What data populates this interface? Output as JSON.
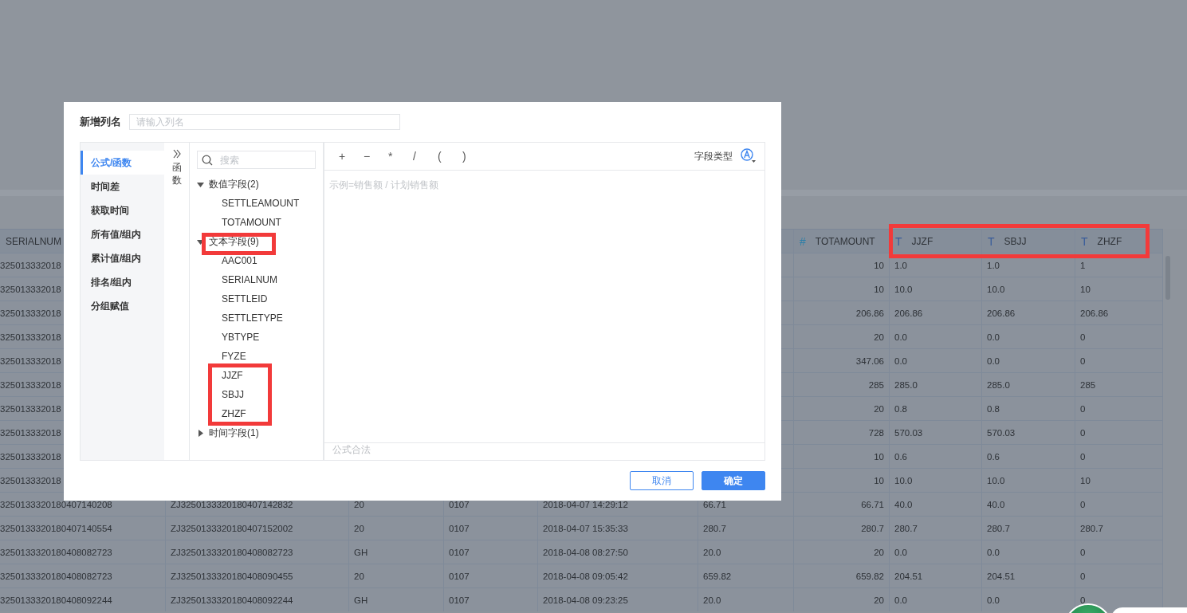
{
  "table": {
    "columns": [
      {
        "label": "SERIALNUM"
      },
      {},
      {},
      {},
      {},
      {},
      {
        "label": "TOTAMOUNT",
        "kind": "number",
        "icon": "#"
      },
      {
        "label": "JJZF",
        "kind": "text",
        "icon": "T"
      },
      {
        "label": "SBJJ",
        "kind": "text",
        "icon": "T"
      },
      {
        "label": "ZHZF",
        "kind": "text",
        "icon": "T"
      }
    ],
    "rows": [
      [
        "325013332018",
        null,
        null,
        null,
        null,
        null,
        "10",
        "1.0",
        "1.0",
        "1"
      ],
      [
        "325013332018",
        null,
        null,
        null,
        null,
        null,
        "10",
        "10.0",
        "10.0",
        "10"
      ],
      [
        "325013332018",
        null,
        null,
        null,
        null,
        null,
        "206.86",
        "206.86",
        "206.86",
        "206.86"
      ],
      [
        "325013332018",
        null,
        null,
        null,
        null,
        null,
        "20",
        "0.0",
        "0.0",
        "0"
      ],
      [
        "325013332018",
        null,
        null,
        null,
        null,
        null,
        "347.06",
        "0.0",
        "0.0",
        "0"
      ],
      [
        "325013332018",
        null,
        null,
        null,
        null,
        null,
        "285",
        "285.0",
        "285.0",
        "285"
      ],
      [
        "325013332018",
        null,
        null,
        null,
        null,
        null,
        "20",
        "0.8",
        "0.8",
        "0"
      ],
      [
        "325013332018",
        null,
        null,
        null,
        null,
        null,
        "728",
        "570.03",
        "570.03",
        "0"
      ],
      [
        "325013332018",
        null,
        null,
        null,
        null,
        null,
        "10",
        "0.6",
        "0.6",
        "0"
      ],
      [
        "325013332018",
        null,
        null,
        null,
        null,
        null,
        "10",
        "10.0",
        "10.0",
        "10"
      ],
      [
        "3250133320180407140208",
        "ZJ3250133320180407142832",
        "20",
        "0107",
        "2018-04-07 14:29:12",
        "66.71",
        "66.71",
        "40.0",
        "40.0",
        "0"
      ],
      [
        "3250133320180407140554",
        "ZJ3250133320180407152002",
        "20",
        "0107",
        "2018-04-07 15:35:33",
        "280.7",
        "280.7",
        "280.7",
        "280.7",
        "280.7"
      ],
      [
        "3250133320180408082723",
        "ZJ3250133320180408082723",
        "GH",
        "0107",
        "2018-04-08 08:27:50",
        "20.0",
        "20",
        "0.0",
        "0.0",
        "0"
      ],
      [
        "3250133320180408082723",
        "ZJ3250133320180408090455",
        "20",
        "0107",
        "2018-04-08 09:05:42",
        "659.82",
        "659.82",
        "204.51",
        "204.51",
        "0"
      ],
      [
        "3250133320180408092244",
        "ZJ3250133320180408092244",
        "GH",
        "0107",
        "2018-04-08 09:23:25",
        "20.0",
        "20",
        "0.0",
        "0.0",
        "0"
      ]
    ]
  },
  "dialog": {
    "title": "新增列名",
    "name_placeholder": "请输入列名",
    "nav": [
      {
        "label": "公式/函数",
        "selected": true
      },
      {
        "label": "时间差",
        "selected": false
      },
      {
        "label": "获取时间",
        "selected": false
      },
      {
        "label": "所有值/组内",
        "selected": false
      },
      {
        "label": "累计值/组内",
        "selected": false
      },
      {
        "label": "排名/组内",
        "selected": false
      },
      {
        "label": "分组赋值",
        "selected": false
      }
    ],
    "function_tab": "函数",
    "search_placeholder": "搜索",
    "field_groups": [
      {
        "label": "数值字段(2)",
        "expanded": true,
        "children": [
          "SETTLEAMOUNT",
          "TOTAMOUNT"
        ]
      },
      {
        "label": "文本字段(9)",
        "expanded": true,
        "children": [
          "AAC001",
          "SERIALNUM",
          "SETTLEID",
          "SETTLETYPE",
          "YBTYPE",
          "FYZE",
          "JJZF",
          "SBJJ",
          "ZHZF"
        ]
      },
      {
        "label": "时间字段(1)",
        "expanded": false
      }
    ],
    "operators": [
      "+",
      "−",
      "*",
      "/",
      "(",
      ")"
    ],
    "field_type_label": "字段类型",
    "formula_placeholder": "示例=销售额 / 计划销售额",
    "status": "公式合法",
    "buttons": [
      {
        "label": "取消",
        "kind": "secondary"
      },
      {
        "label": "确定",
        "kind": "primary"
      }
    ]
  }
}
